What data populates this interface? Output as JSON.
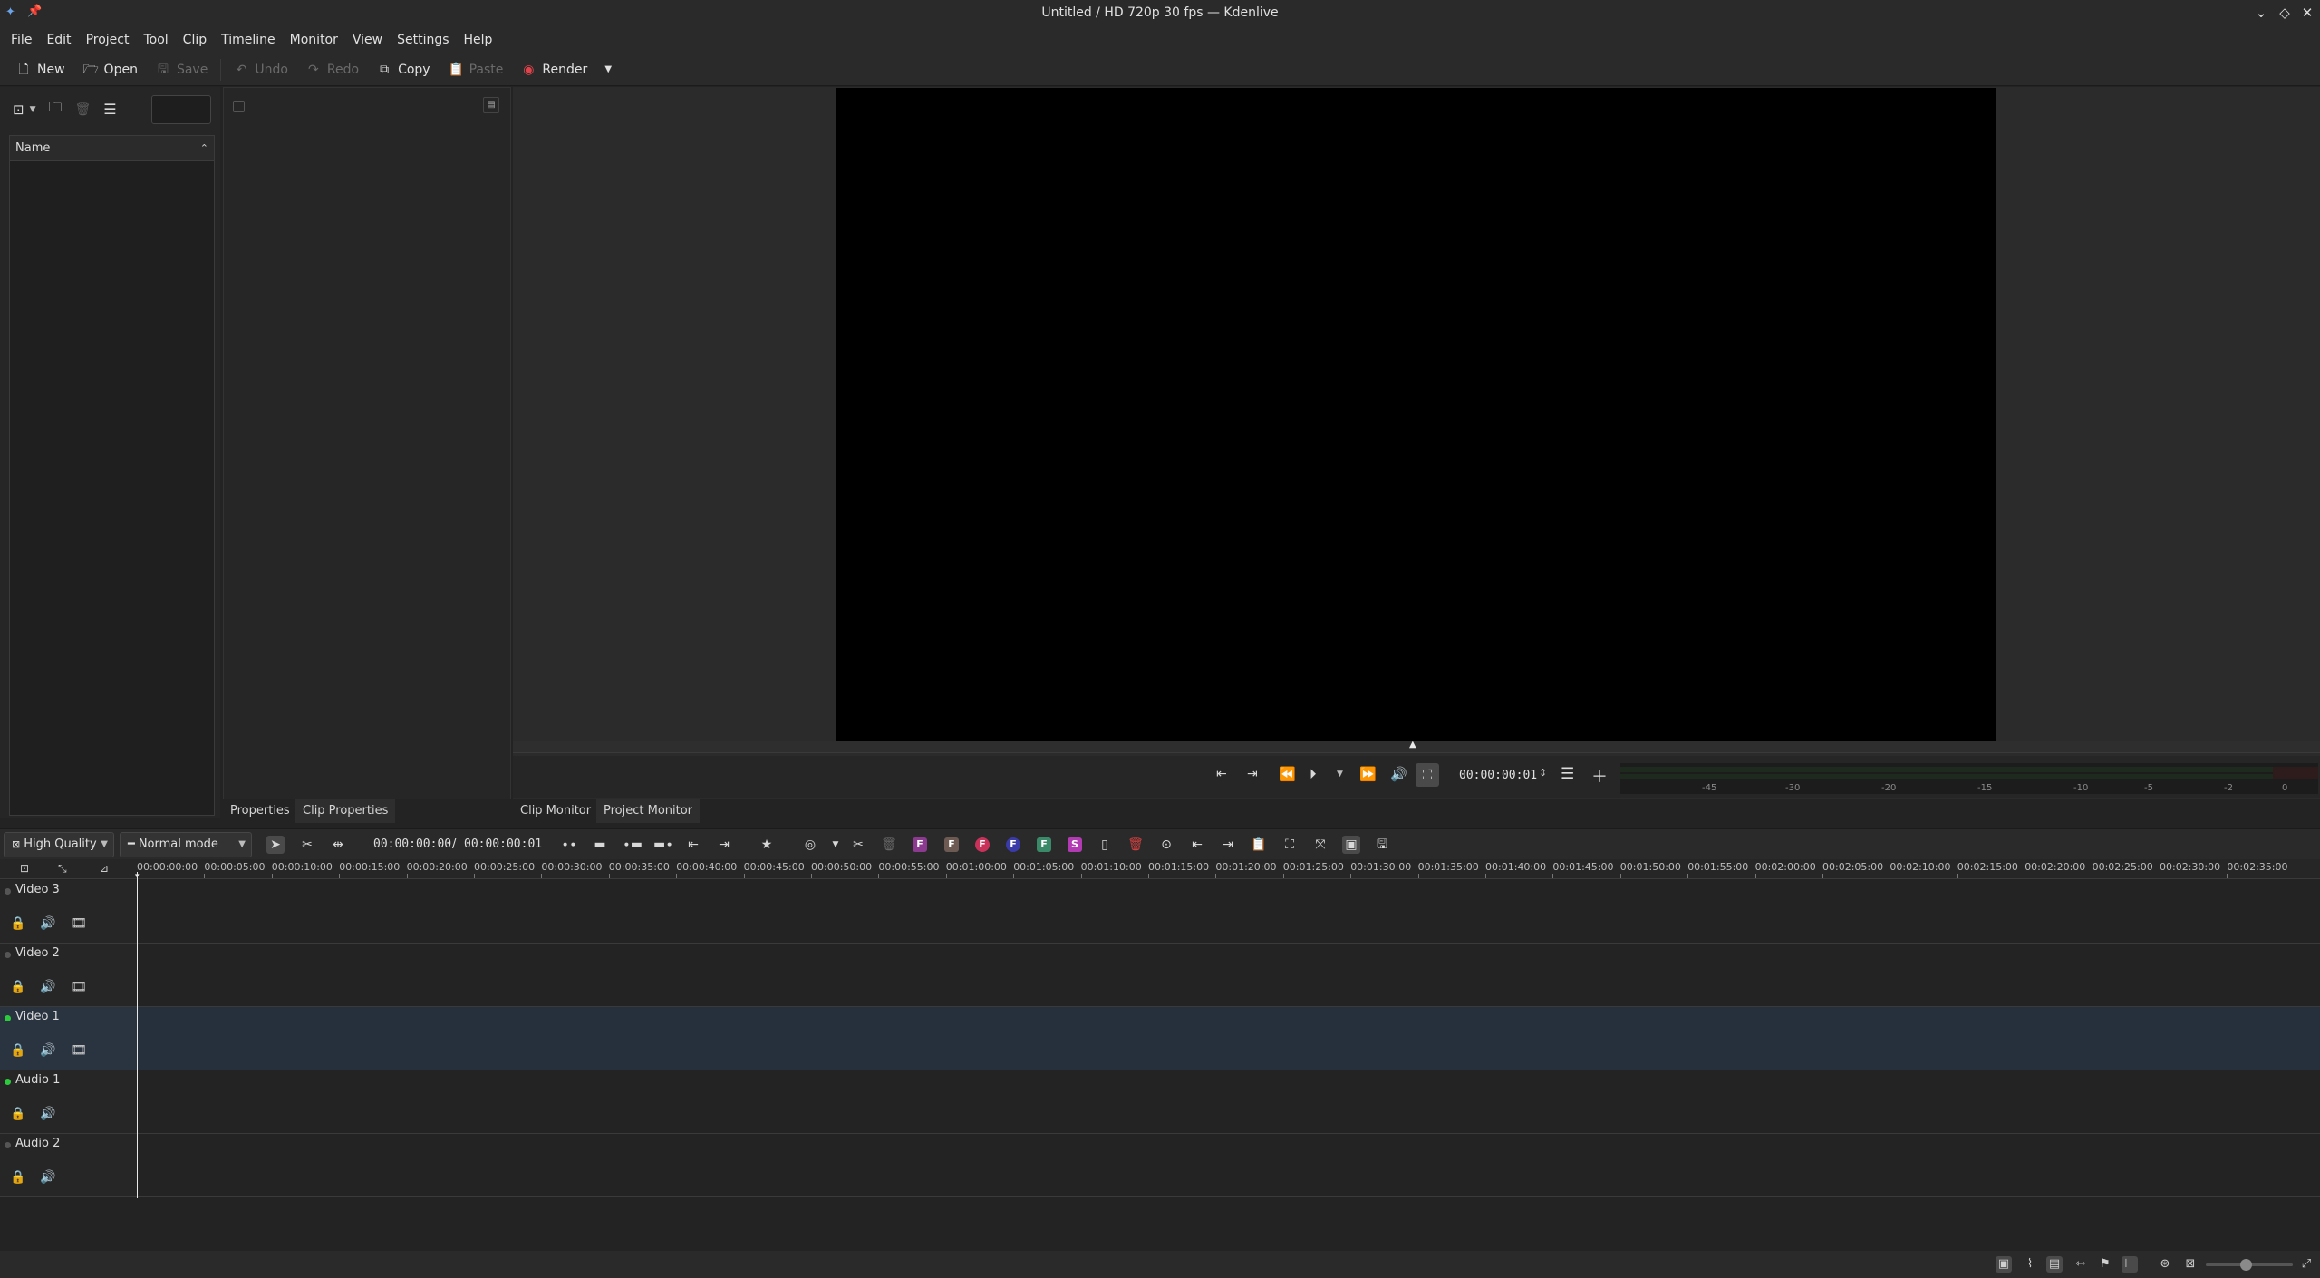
{
  "window": {
    "title": "Untitled / HD 720p 30 fps — Kdenlive"
  },
  "menu": [
    "File",
    "Edit",
    "Project",
    "Tool",
    "Clip",
    "Timeline",
    "Monitor",
    "View",
    "Settings",
    "Help"
  ],
  "toolbar": {
    "new": "New",
    "open": "Open",
    "save": "Save",
    "undo": "Undo",
    "redo": "Redo",
    "copy": "Copy",
    "paste": "Paste",
    "render": "Render"
  },
  "bin": {
    "column_name": "Name",
    "search_value": ""
  },
  "dock_tabs_left": [
    "Properties",
    "Clip Properties"
  ],
  "dock_tabs_monitor": [
    "Clip Monitor",
    "Project Monitor"
  ],
  "monitor": {
    "timecode": "00:00:00:01"
  },
  "vu_meter": {
    "labels": [
      "-45",
      "-30",
      "-20",
      "-15",
      "-10",
      "-5",
      "-2",
      "0"
    ]
  },
  "timeline_toolbar": {
    "quality": "High Quality",
    "mode": "Normal mode",
    "position": "00:00:00:00",
    "separator": "/",
    "duration": "00:00:00:01"
  },
  "ruler_ticks": [
    "00:00:00:00",
    "00:00:05:00",
    "00:00:10:00",
    "00:00:15:00",
    "00:00:20:00",
    "00:00:25:00",
    "00:00:30:00",
    "00:00:35:00",
    "00:00:40:00",
    "00:00:45:00",
    "00:00:50:00",
    "00:00:55:00",
    "00:01:00:00",
    "00:01:05:00",
    "00:01:10:00",
    "00:01:15:00",
    "00:01:20:00",
    "00:01:25:00",
    "00:01:30:00",
    "00:01:35:00",
    "00:01:40:00",
    "00:01:45:00",
    "00:01:50:00",
    "00:01:55:00",
    "00:02:00:00",
    "00:02:05:00",
    "00:02:10:00",
    "00:02:15:00",
    "00:02:20:00",
    "00:02:25:00",
    "00:02:30:00",
    "00:02:35:00"
  ],
  "tracks": [
    {
      "name": "Video 3",
      "type": "video",
      "active": false,
      "selected": false
    },
    {
      "name": "Video 2",
      "type": "video",
      "active": false,
      "selected": false
    },
    {
      "name": "Video 1",
      "type": "video",
      "active": true,
      "selected": true
    },
    {
      "name": "Audio 1",
      "type": "audio",
      "active": true,
      "selected": false
    },
    {
      "name": "Audio 2",
      "type": "audio",
      "active": false,
      "selected": false
    }
  ],
  "colors": {
    "accent_green": "#2bcc3b",
    "render_red": "#e0434b",
    "selected_track": "#26303c"
  }
}
